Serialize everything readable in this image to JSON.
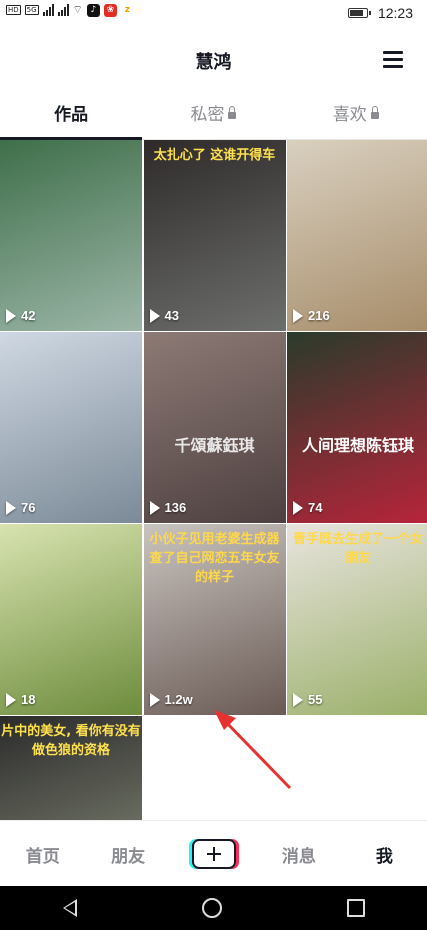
{
  "status_bar": {
    "left_tags": [
      "HD",
      "5G",
      "HD"
    ],
    "time": "12:23",
    "battery_level": 0.85,
    "icons": [
      "signal-icon",
      "wifi-icon",
      "tiktok-app-icon",
      "pinduoduo-app-icon",
      "z-app-icon"
    ]
  },
  "header": {
    "title": "慧鸿",
    "menu_icon": "hamburger-menu-icon"
  },
  "tabs": [
    {
      "label": "作品",
      "active": true,
      "locked": false
    },
    {
      "label": "私密",
      "active": false,
      "locked": true
    },
    {
      "label": "喜欢",
      "active": false,
      "locked": true
    }
  ],
  "videos": [
    {
      "count": "42",
      "colors": [
        "#3f6f4a",
        "#9cb6a8"
      ]
    },
    {
      "count": "43",
      "colors": [
        "#2e2a2a",
        "#6d6f6c"
      ],
      "top_text": "太扎心了 这谁开得车",
      "top_color": "#ffe14d"
    },
    {
      "count": "216",
      "colors": [
        "#d9d0c0",
        "#a78d6a"
      ]
    },
    {
      "count": "76",
      "colors": [
        "#cfd8e3",
        "#7b8a97"
      ]
    },
    {
      "count": "136",
      "colors": [
        "#8d7a75",
        "#4d4040"
      ],
      "mid_text": "千頌蘇鈺琪",
      "mid_color": "#e9e9e9"
    },
    {
      "count": "74",
      "colors": [
        "#2a3b2b",
        "#b7243a"
      ],
      "mid_text": "人间理想陈钰琪",
      "mid_color": "#ffffff"
    },
    {
      "count": "18",
      "colors": [
        "#d8e3b0",
        "#6d8c3c"
      ]
    },
    {
      "count": "1.2w",
      "colors": [
        "#c9c4bf",
        "#6a5a55"
      ],
      "top_text": "小伙子见用老婆生成器查了自己网恋五年女友的样子",
      "top_color": "#ffd84a"
    },
    {
      "count": "55",
      "colors": [
        "#e8e4de",
        "#9bb06a"
      ],
      "top_text": "晋手既去生成了一个女朋友",
      "top_color": "#ffd84a"
    },
    {
      "count": "",
      "colors": [
        "#2b2b2b",
        "#8a8f7c"
      ],
      "top_text": "片中的美女, 看你有没有做色狼的资格",
      "top_color": "#ffe14d"
    }
  ],
  "bottom_nav": {
    "home": "首页",
    "friends": "朋友",
    "messages": "消息",
    "me": "我"
  }
}
